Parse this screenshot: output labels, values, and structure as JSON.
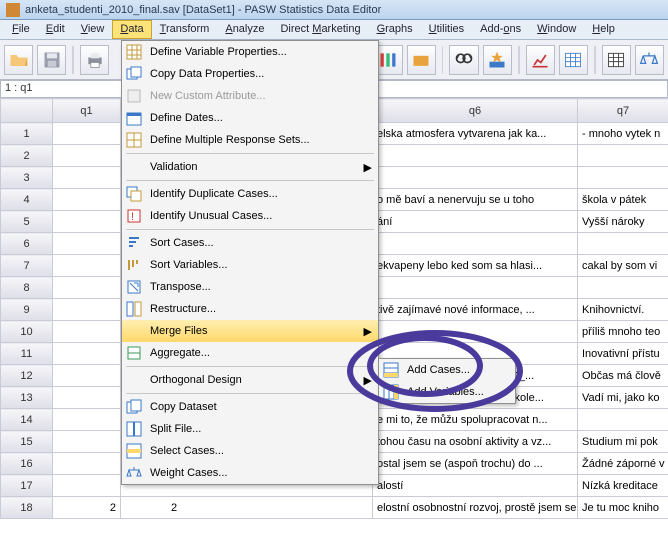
{
  "title": "anketa_studenti_2010_final.sav [DataSet1] - PASW Statistics Data Editor",
  "menubar": {
    "file": "File",
    "edit": "Edit",
    "view": "View",
    "data": "Data",
    "transform": "Transform",
    "analyze": "Analyze",
    "dm": "Direct Marketing",
    "graphs": "Graphs",
    "utilities": "Utilities",
    "addons": "Add-ons",
    "window": "Window",
    "help": "Help"
  },
  "cellref": "1 : q1",
  "headers": {
    "q1": "q1",
    "q6": "q6",
    "q7": "q7"
  },
  "menu": {
    "dvp": "Define Variable Properties...",
    "cdp": "Copy Data Properties...",
    "nca": "New Custom Attribute...",
    "dd": "Define Dates...",
    "dmrs": "Define Multiple Response Sets...",
    "val": "Validation",
    "idc": "Identify Duplicate Cases...",
    "iuc": "Identify Unusual Cases...",
    "sc": "Sort Cases...",
    "sv": "Sort Variables...",
    "tp": "Transpose...",
    "rs": "Restructure...",
    "mf": "Merge Files",
    "ag": "Aggregate...",
    "od": "Orthogonal Design",
    "cds": "Copy Dataset",
    "sf": "Split File...",
    "selc": "Select Cases...",
    "wc": "Weight Cases..."
  },
  "submenu": {
    "ac": "Add Cases...",
    "av": "Add Variables..."
  },
  "rows": [
    {
      "n": "1",
      "q6": "elska atmosfera vytvarena jak ka...",
      "q7": "- mnoho vytek n"
    },
    {
      "n": "2",
      "q6": "",
      "q7": ""
    },
    {
      "n": "3",
      "q6": "",
      "q7": ""
    },
    {
      "n": "4",
      "q6": "o mě baví a nenervuju se u toho",
      "q7": "škola v pátek"
    },
    {
      "n": "5",
      "q6": "ání",
      "q7": "Vyšší nároky"
    },
    {
      "n": "6",
      "q6": "",
      "q7": ""
    },
    {
      "n": "7",
      "q6": "ekvapeny lebo ked som sa hlasi...",
      "q7": "cakal by som vi"
    },
    {
      "n": "8",
      "q6": "",
      "q7": ""
    },
    {
      "n": "9",
      "q6": "tivě zajímavé nové informace, ...",
      "q7": "Knihovnictví."
    },
    {
      "n": "10",
      "q6": "",
      "q7": "příliš mnoho teo"
    },
    {
      "n": "11",
      "q6": "",
      "q7": "Inovativní přístu"
    },
    {
      "n": "12",
      "q6": "a pestrost předmětů, _x000D_...",
      "q7": "Občas má člově"
    },
    {
      "n": "13",
      "q6": "amostatné myšlení, práce v kole...",
      "q7": "Vadí mi, jako ko"
    },
    {
      "n": "14",
      "q6": "e mi to, že můžu spolupracovat n...",
      "q7": ""
    },
    {
      "n": "15",
      "q6": "tohou času na osobní aktivity a vz...",
      "q7": "Studium mi pok"
    },
    {
      "n": "16",
      "q6": "ostal jsem se (aspoň trochu) do ...",
      "q7": "Žádné záporné v"
    },
    {
      "n": "17",
      "q6": "alostí",
      "q7": "Nízká kreditace"
    },
    {
      "n": "18",
      "q1a": "2",
      "q1b": "2",
      "q6": "elostní osobnostní rozvoj, prostě jsem se ...",
      "q7": "Je tu moc kniho"
    }
  ]
}
